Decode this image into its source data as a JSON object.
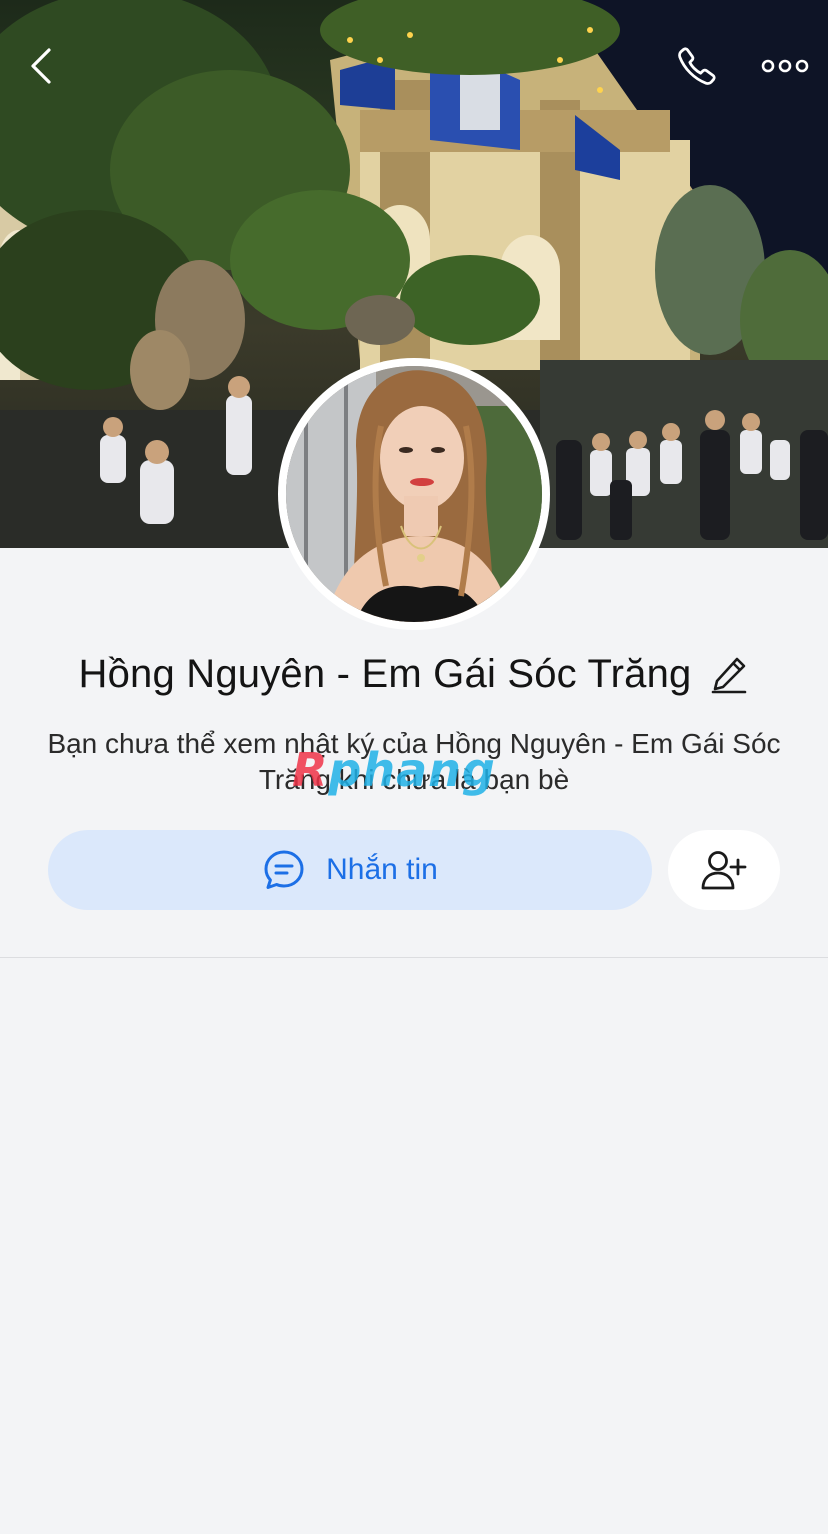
{
  "profile": {
    "name": "Hồng Nguyên - Em Gái Sóc Trăng",
    "notice": "Bạn chưa thể xem nhật ký của Hồng Nguyên - Em Gái Sóc Trăng khi chưa là bạn bè"
  },
  "actions": {
    "message_label": "Nhắn tin"
  },
  "watermark": {
    "part1": "R",
    "part2": "phang"
  },
  "icons": {
    "back": "chevron-left-icon",
    "call": "phone-icon",
    "more": "ellipsis-icon",
    "edit": "pencil-icon",
    "message": "chat-bubble-icon",
    "add_friend": "user-plus-icon"
  },
  "colors": {
    "accent": "#1c6fe6",
    "message_button_bg": "#dbe8fb",
    "page_bg": "#f3f4f6"
  }
}
